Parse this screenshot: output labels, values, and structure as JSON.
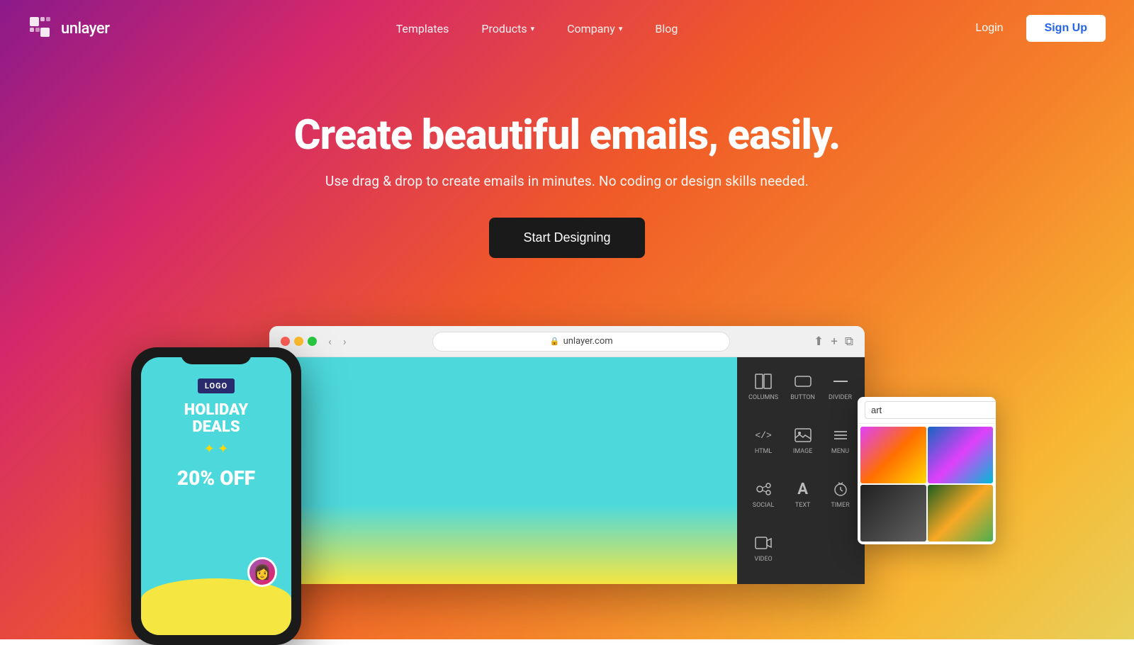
{
  "brand": {
    "name": "unlayer",
    "logo_alt": "unlayer logo"
  },
  "nav": {
    "items": [
      {
        "label": "Templates",
        "has_dropdown": false
      },
      {
        "label": "Products",
        "has_dropdown": true
      },
      {
        "label": "Company",
        "has_dropdown": true
      },
      {
        "label": "Blog",
        "has_dropdown": false
      }
    ]
  },
  "auth": {
    "login_label": "Login",
    "signup_label": "Sign Up"
  },
  "hero": {
    "title": "Create beautiful emails, easily.",
    "subtitle": "Use drag & drop to create emails in minutes. No coding or design skills needed.",
    "cta_label": "Start Designing"
  },
  "browser": {
    "url": "unlayer.com",
    "nav_back": "‹",
    "nav_forward": "›"
  },
  "editor_sidebar": {
    "items": [
      {
        "icon": "⊞",
        "label": "COLUMNS"
      },
      {
        "icon": "□",
        "label": "BUTTON"
      },
      {
        "icon": "—",
        "label": "DIVIDER"
      },
      {
        "icon": "</>",
        "label": "HTML"
      },
      {
        "icon": "🖼",
        "label": "IMAGE"
      },
      {
        "icon": "☰",
        "label": "MENU"
      },
      {
        "icon": "👥",
        "label": "SOCIAL"
      },
      {
        "icon": "A",
        "label": "TEXT"
      },
      {
        "icon": "⏱",
        "label": "TIMER"
      },
      {
        "icon": "▶",
        "label": "VIDEO"
      }
    ]
  },
  "phone": {
    "logo": "LOGO",
    "line1": "HOLIDAY",
    "line2": "DEALS",
    "discount": "20% OFF"
  },
  "image_search": {
    "placeholder": "art",
    "clear_label": "×"
  }
}
